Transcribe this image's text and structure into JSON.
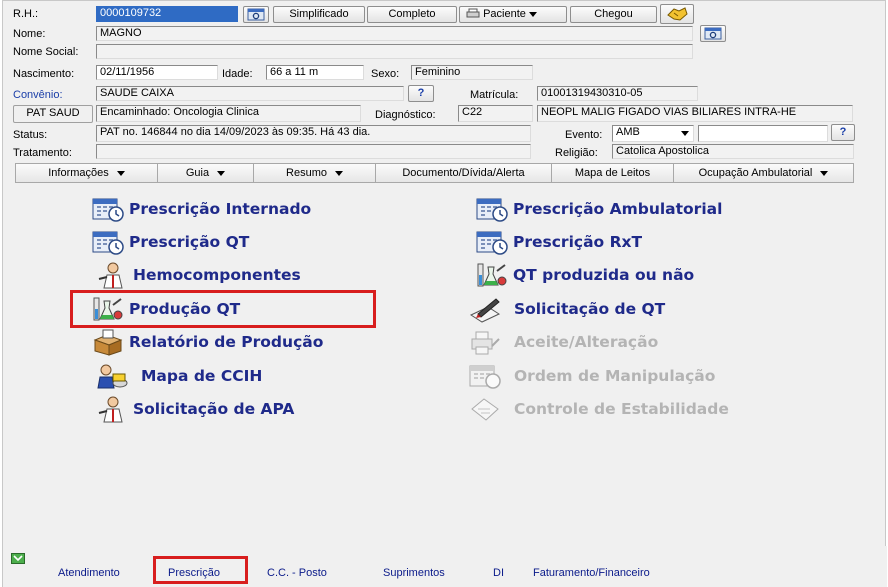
{
  "header": {
    "rh_label": "R.H.:",
    "rh_value": "0000109732",
    "btn_simplificado": "Simplificado",
    "btn_completo": "Completo",
    "btn_paciente": "Paciente",
    "btn_chegou": "Chegou",
    "nome_label": "Nome:",
    "nome_value": "MAGNO",
    "nome_social_label": "Nome Social:",
    "nome_social_value": "",
    "nascimento_label": "Nascimento:",
    "nascimento_value": "02/11/1956",
    "idade_label": "Idade:",
    "idade_value": "66 a 11 m",
    "sexo_label": "Sexo:",
    "sexo_value": "Feminino",
    "convenio_label": "Convênio:",
    "convenio_value": "SAUDE CAIXA",
    "matricula_label": "Matrícula:",
    "matricula_value": "01001319430310-05",
    "pat_saud_button": "PAT SAUD",
    "encaminhado_value": "Encaminhado: Oncologia Clinica",
    "diagnostico_label": "Diagnóstico:",
    "diagnostico_code": "C22",
    "diagnostico_desc": "NEOPL MALIG FIGADO VIAS BILIARES INTRA-HE",
    "status_label": "Status:",
    "status_value": "PAT no. 146844 no dia 14/09/2023  às  09:35. Há 43 dia.",
    "evento_label": "Evento:",
    "evento_value": "AMB",
    "evento_extra": "",
    "tratamento_label": "Tratamento:",
    "tratamento_value": "",
    "religiao_label": "Religião:",
    "religiao_value": "Catolica Apostolica",
    "help_label": "?"
  },
  "tabs": [
    {
      "label": "Informações",
      "dropdown": true
    },
    {
      "label": "Guia",
      "dropdown": true
    },
    {
      "label": "Resumo",
      "dropdown": true
    },
    {
      "label": "Documento/Dívida/Alerta",
      "dropdown": false
    },
    {
      "label": "Mapa de Leitos",
      "dropdown": false
    },
    {
      "label": "Ocupação Ambulatorial",
      "dropdown": true
    }
  ],
  "menu_left": [
    {
      "label": "Prescrição Internado",
      "icon": "calendar-clock-icon",
      "enabled": true
    },
    {
      "label": "Prescrição QT",
      "icon": "calendar-clock-icon",
      "enabled": true
    },
    {
      "label": "Hemocomponentes",
      "icon": "doctor-icon",
      "enabled": true
    },
    {
      "label": "Produção QT",
      "icon": "lab-flasks-icon",
      "enabled": true,
      "highlighted": true
    },
    {
      "label": "Relatório de Produção",
      "icon": "box-report-icon",
      "enabled": true
    },
    {
      "label": "Mapa de CCIH",
      "icon": "person-map-icon",
      "enabled": true
    },
    {
      "label": "Solicitação de APA",
      "icon": "doctor-icon",
      "enabled": true
    }
  ],
  "menu_right": [
    {
      "label": "Prescrição Ambulatorial",
      "icon": "calendar-clock-icon",
      "enabled": true
    },
    {
      "label": "Prescrição RxT",
      "icon": "calendar-clock-icon",
      "enabled": true
    },
    {
      "label": "QT produzida ou não",
      "icon": "lab-flasks-icon",
      "enabled": true
    },
    {
      "label": "Solicitação de QT",
      "icon": "pen-paper-icon",
      "enabled": true
    },
    {
      "label": "Aceite/Alteração",
      "icon": "printer-gray-icon",
      "enabled": false
    },
    {
      "label": "Ordem de Manipulação",
      "icon": "calendar-gray-icon",
      "enabled": false
    },
    {
      "label": "Controle de Estabilidade",
      "icon": "clipboard-gray-icon",
      "enabled": false
    }
  ],
  "bottom_tabs": [
    {
      "label": "Atendimento"
    },
    {
      "label": "Prescrição",
      "highlighted": true
    },
    {
      "label": "C.C. - Posto"
    },
    {
      "label": "Suprimentos"
    },
    {
      "label": "DI"
    },
    {
      "label": "Faturamento/Financeiro"
    }
  ],
  "colors": {
    "menu_text": "#1f2a8a",
    "menu_disabled": "#b4b4b4",
    "highlight": "#d81e1e",
    "selection": "#2f6bc4",
    "label_blue": "#1a3ea8"
  }
}
